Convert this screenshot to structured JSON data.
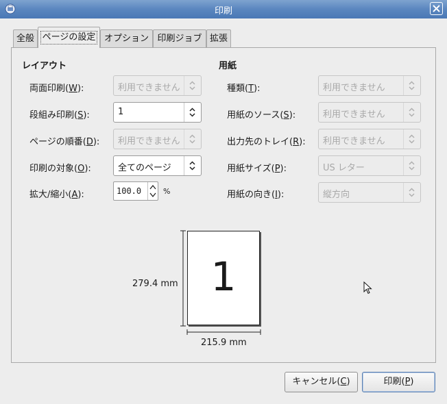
{
  "window": {
    "title": "印刷"
  },
  "tabs": [
    {
      "label": "全般"
    },
    {
      "label": "ページの設定"
    },
    {
      "label": "オプション"
    },
    {
      "label": "印刷ジョブ"
    },
    {
      "label": "拡張"
    }
  ],
  "layout": {
    "heading": "レイアウト",
    "duplex": {
      "label": "両面印刷(W):",
      "value": "利用できません"
    },
    "columns": {
      "label": "段組み印刷(S):",
      "value": "1"
    },
    "page_order": {
      "label": "ページの順番(D):",
      "value": "利用できません"
    },
    "print_range": {
      "label": "印刷の対象(O):",
      "value": "全てのページ"
    },
    "scale": {
      "label": "拡大/縮小(A):",
      "value": "100.0",
      "unit": "%"
    }
  },
  "paper": {
    "heading": "用紙",
    "type": {
      "label": "種類(T):",
      "value": "利用できません"
    },
    "source": {
      "label": "用紙のソース(S):",
      "value": "利用できません"
    },
    "output_tray": {
      "label": "出力先のトレイ(R):",
      "value": "利用できません"
    },
    "size": {
      "label": "用紙サイズ(P):",
      "value": "US レター"
    },
    "orientation": {
      "label": "用紙の向き(I):",
      "value": "縦方向"
    }
  },
  "preview": {
    "page_number": "1",
    "height": "279.4 mm",
    "width": "215.9 mm"
  },
  "buttons": {
    "cancel": "キャンセル(C)",
    "print": "印刷(P)"
  }
}
